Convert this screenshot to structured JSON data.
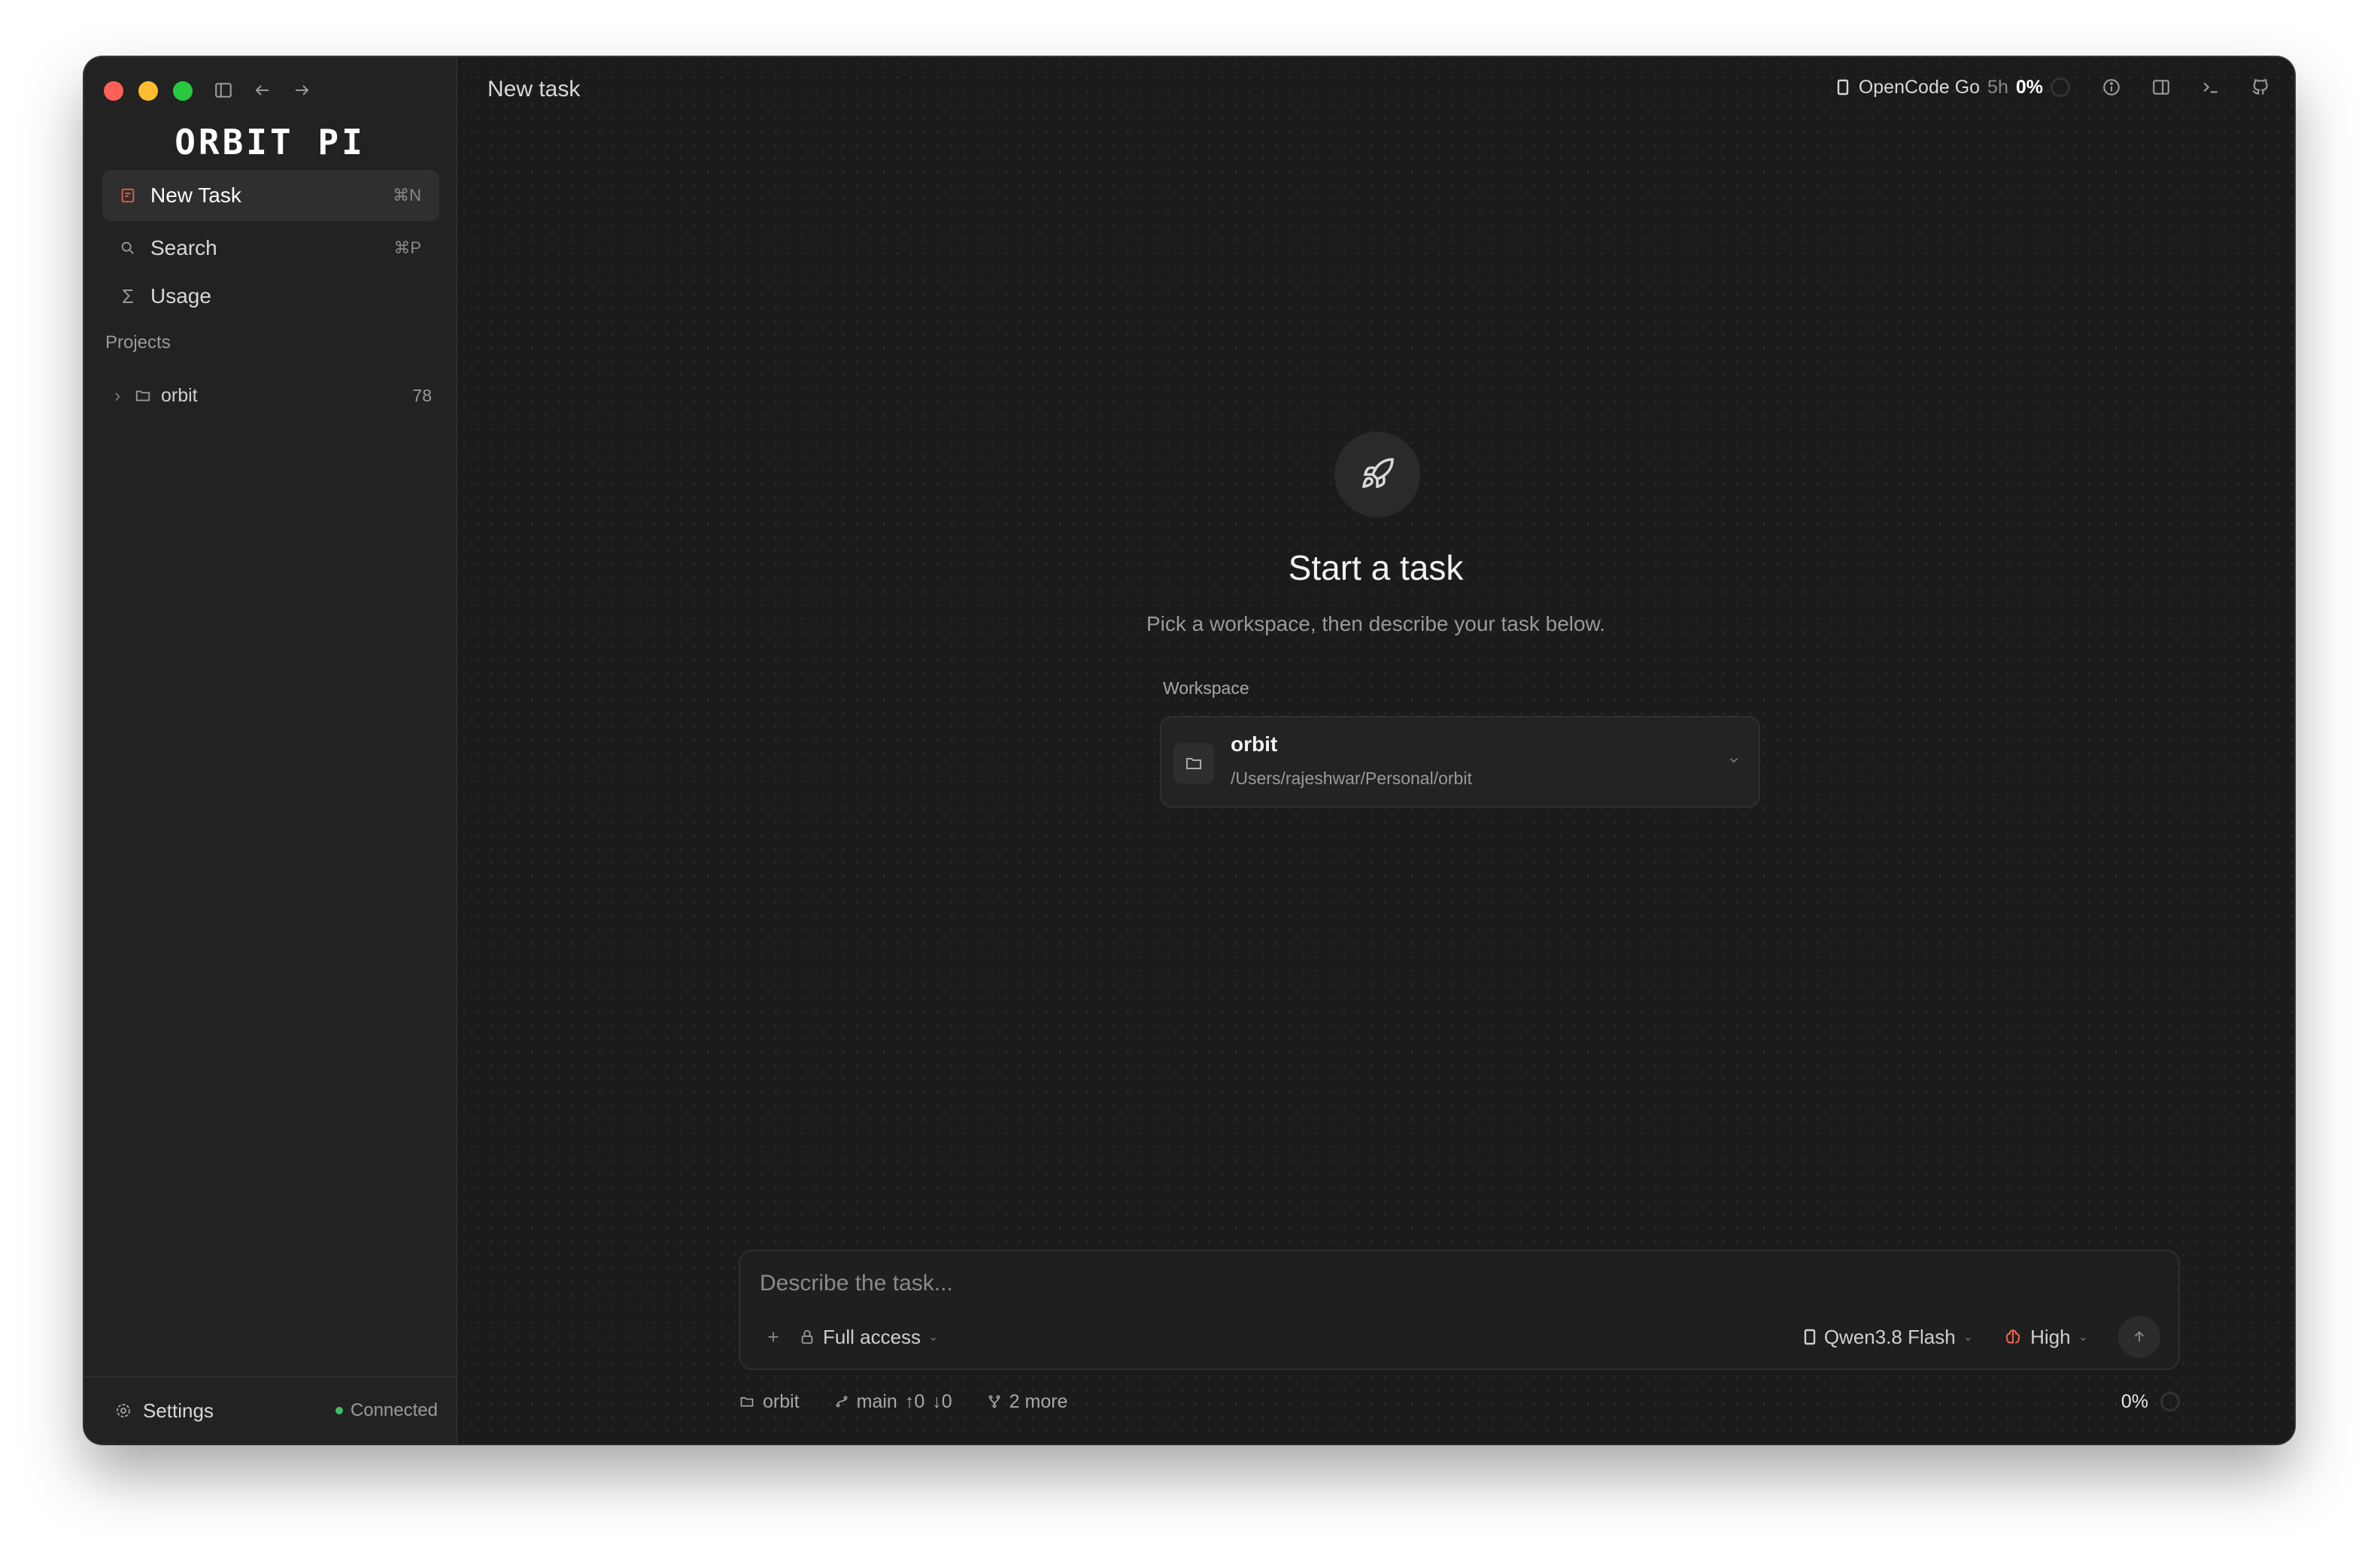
{
  "app": {
    "logo": "ORBIT PI"
  },
  "sidebar": {
    "new_task": {
      "label": "New Task",
      "shortcut": "⌘N"
    },
    "search": {
      "label": "Search",
      "shortcut": "⌘P"
    },
    "usage": {
      "label": "Usage"
    },
    "projects_label": "Projects",
    "projects": [
      {
        "name": "orbit",
        "count": "78"
      }
    ],
    "settings_label": "Settings",
    "status": "Connected"
  },
  "header": {
    "title": "New task",
    "model": "OpenCode Go",
    "window": "5h",
    "percent": "0%"
  },
  "main": {
    "heading": "Start a task",
    "subheading": "Pick a workspace, then describe your task below.",
    "workspace_label": "Workspace",
    "workspace": {
      "name": "orbit",
      "path": "/Users/rajeshwar/Personal/orbit"
    }
  },
  "composer": {
    "placeholder": "Describe the task...",
    "access": "Full access",
    "model": "Qwen3.8 Flash",
    "effort": "High"
  },
  "footer": {
    "project": "orbit",
    "branch": "main",
    "ahead": "↑0",
    "behind": "↓0",
    "worktrees": "2 more",
    "percent": "0%"
  },
  "colors": {
    "accent": "#e8604c",
    "status_ok": "#3fbf5f"
  }
}
